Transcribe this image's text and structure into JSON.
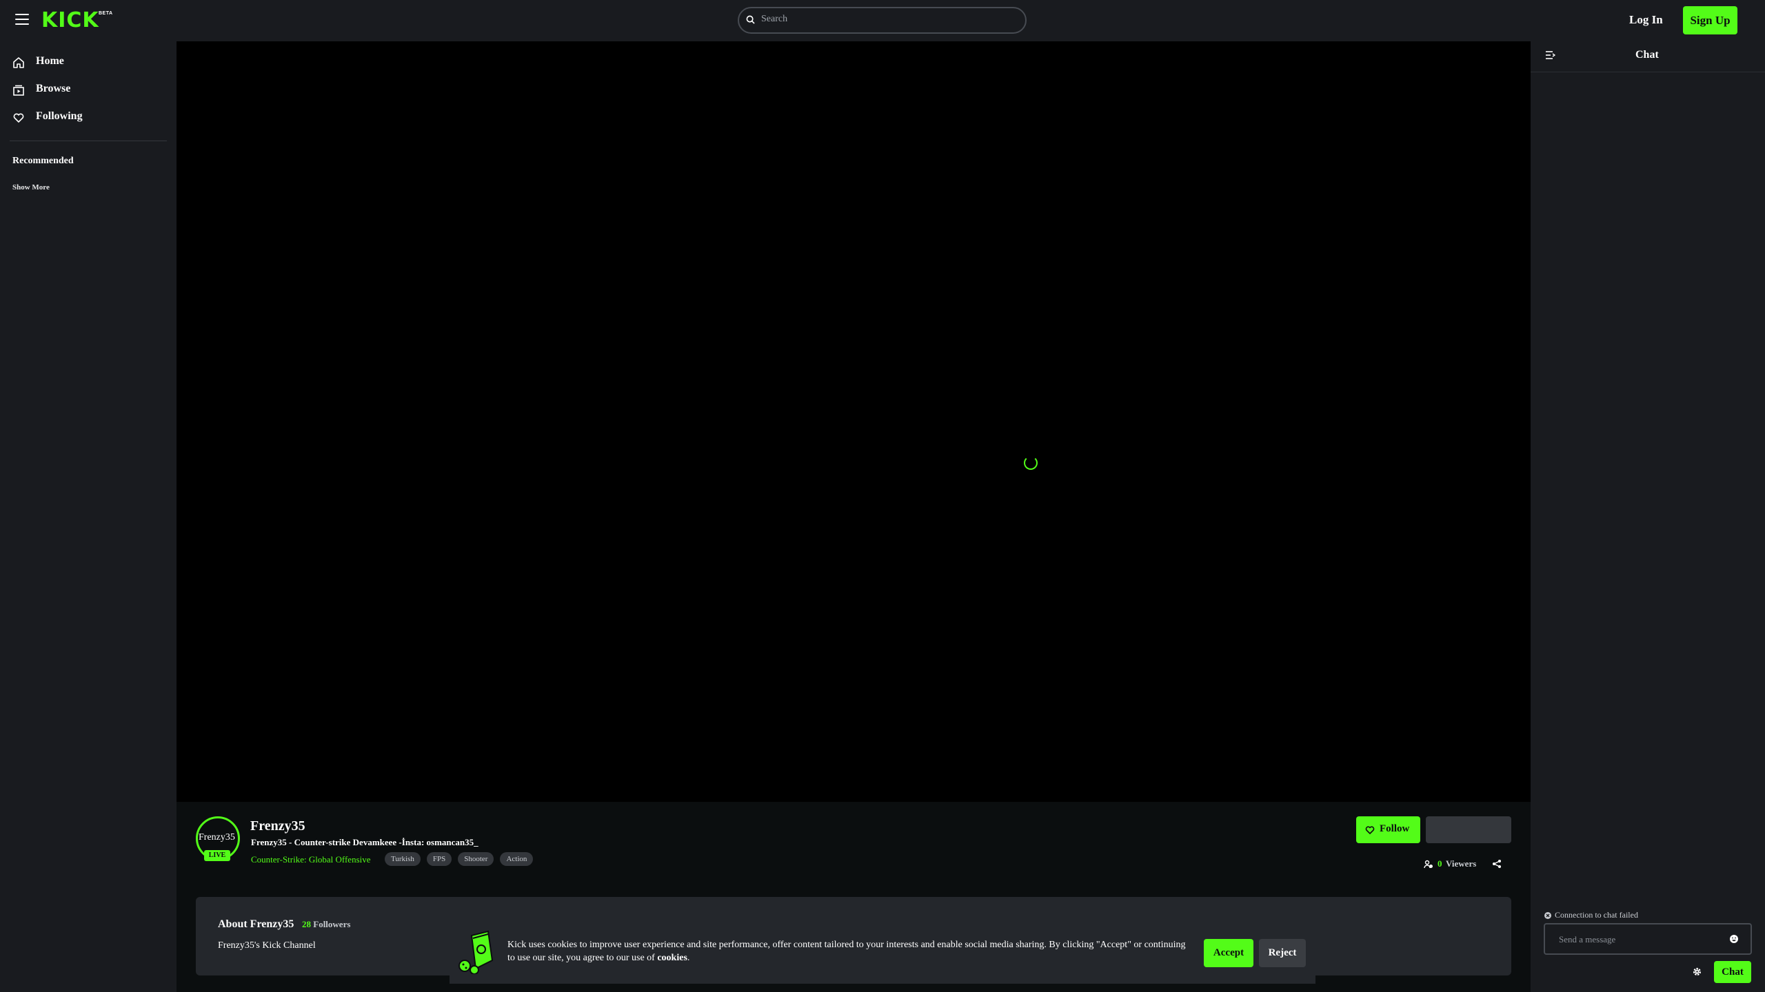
{
  "header": {
    "logo_text": "KICK",
    "logo_badge": "BETA",
    "search_placeholder": "Search",
    "login_label": "Log In",
    "signup_label": "Sign Up"
  },
  "sidebar": {
    "items": [
      {
        "label": "Home",
        "icon": "home-icon"
      },
      {
        "label": "Browse",
        "icon": "browse-icon"
      },
      {
        "label": "Following",
        "icon": "heart-icon"
      }
    ],
    "recommended_title": "Recommended",
    "show_more": "Show More"
  },
  "stream": {
    "avatar_alt": "Frenzy35",
    "live_badge": "LIVE",
    "channel_name": "Frenzy35",
    "title": "Frenzy35 - Counter-strike  Devamkeee  -İnsta: osmancan35_",
    "category": "Counter-Strike: Global Offensive",
    "tags": [
      "Turkish",
      "FPS",
      "Shooter",
      "Action"
    ],
    "follow_label": "Follow",
    "viewer_count": "0",
    "viewers_label": "Viewers"
  },
  "about": {
    "title": "About Frenzy35",
    "followers_count": "28",
    "followers_label": "Followers",
    "description": "Frenzy35's Kick Channel"
  },
  "cookie_banner": {
    "text_before": "Kick uses cookies to improve user experience and site performance, offer content tailored to your interests and enable social media sharing. By clicking \"Accept\" or continuing to use our site, you agree to our use of ",
    "link_text": "cookies",
    "text_after": ".",
    "accept_label": "Accept",
    "reject_label": "Reject"
  },
  "chat": {
    "title": "Chat",
    "status": "Connection to chat failed",
    "input_placeholder": "Send a message",
    "send_label": "Chat"
  },
  "colors": {
    "accent": "#53fc18",
    "background": "#0b0e0f",
    "panel": "#191b1f",
    "card": "#24272c"
  }
}
